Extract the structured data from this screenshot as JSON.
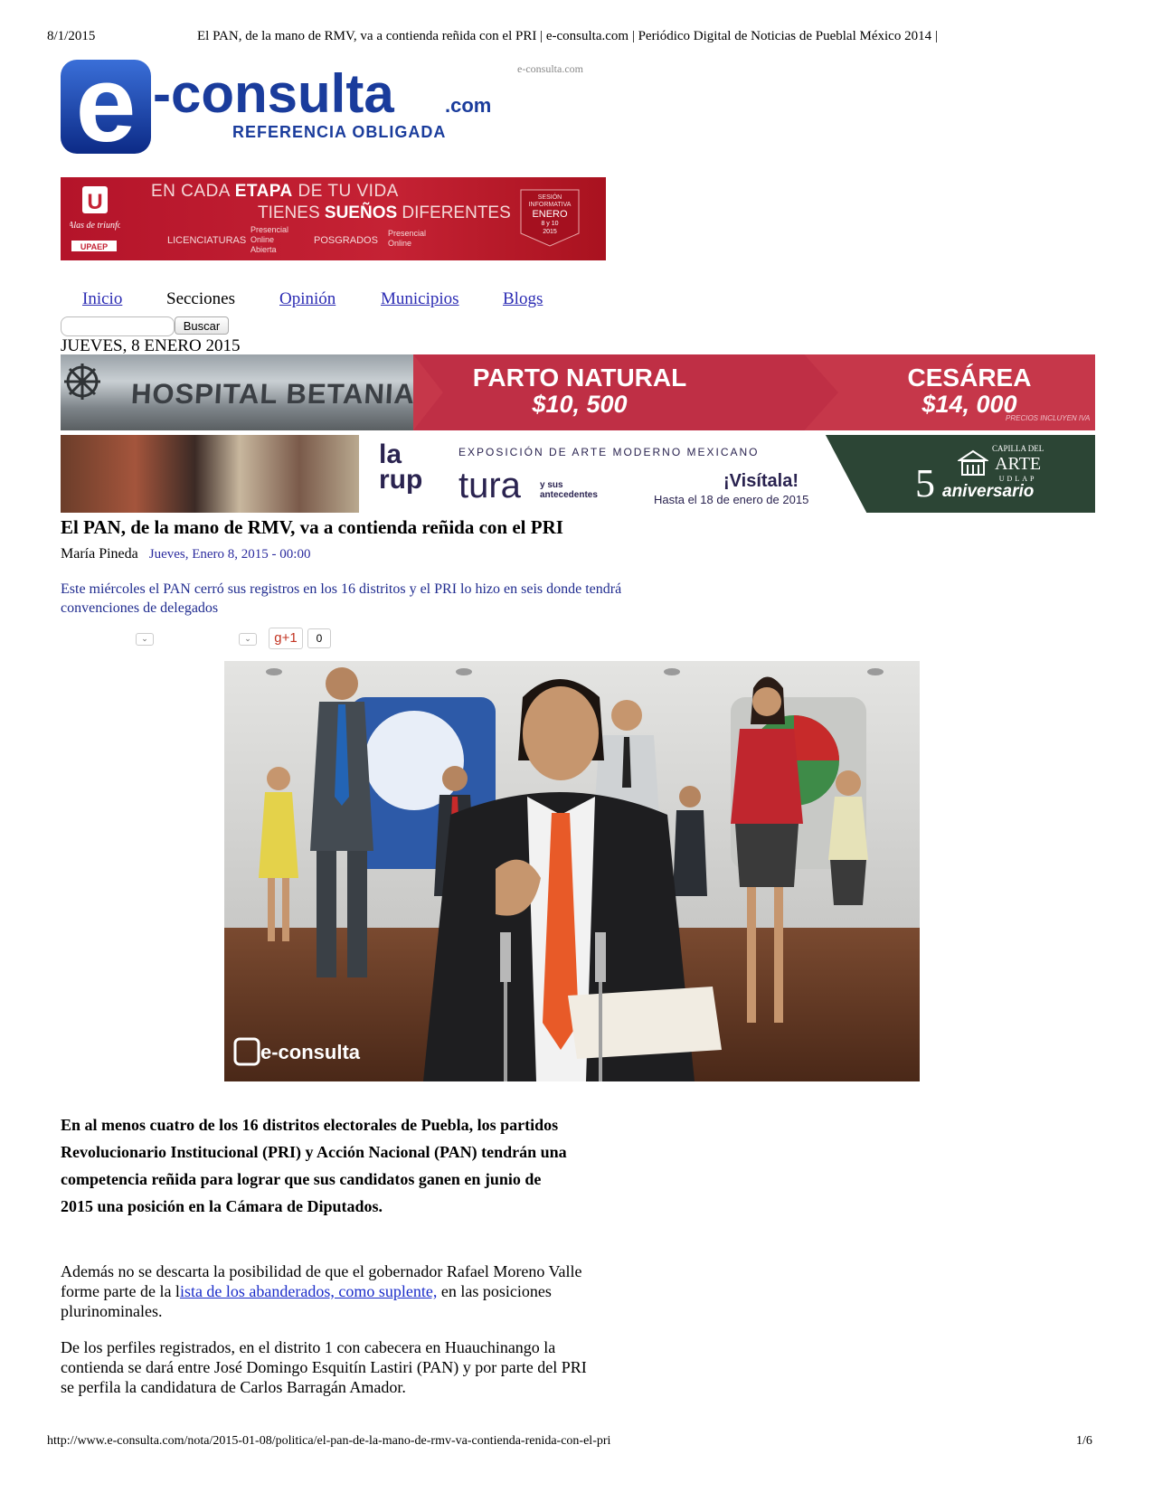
{
  "print_header": {
    "date": "8/1/2015",
    "title": "El PAN, de la mano de RMV, va a contienda reñida con el PRI | e-consulta.com | Periódico Digital de Noticias de Pueblal México 2014 |"
  },
  "logo": {
    "letter": "e",
    "name": "-consulta",
    "tld": ".com",
    "tagline": "REFERENCIA OBLIGADA",
    "site_label": "e-consulta.com",
    "colors": {
      "blue": "#1a3c9c",
      "dark": "#0a1f6e"
    }
  },
  "ad_upaep": {
    "line1_pre": "EN CADA ",
    "line1_bold": "ETAPA",
    "line1_post": " DE TU VIDA",
    "line2_pre": "TIENES ",
    "line2_bold": "SUEÑOS",
    "line2_post": " DIFERENTES",
    "licenciaturas": "LICENCIATURAS",
    "lic_sub": "Presencial\nOnline\nAbierta",
    "posgrados": "POSGRADOS",
    "pos_sub": "Presencial\nOnline",
    "badge_l1": "SESIÓN",
    "badge_l2": "INFORMATIVA",
    "badge_l3": "ENERO",
    "badge_l4": "8 y 10",
    "badge_l5": "2015",
    "brand": "UPAEP",
    "slogan": "Alas de triunfo",
    "logo_letter": "U"
  },
  "nav": {
    "items": [
      {
        "label": "Inicio",
        "link": true
      },
      {
        "label": "Secciones",
        "link": false
      },
      {
        "label": "Opinión",
        "link": true
      },
      {
        "label": "Municipios",
        "link": true
      },
      {
        "label": "Blogs",
        "link": true
      }
    ]
  },
  "search": {
    "button": "Buscar",
    "value": ""
  },
  "dateline": "JUEVES, 8 ENERO 2015",
  "ad_betania": {
    "name": "HOSPITAL BETANIA",
    "offer1": "PARTO NATURAL",
    "price1": "$10, 500",
    "offer2": "CESÁREA",
    "price2": "$14, 000",
    "note": "PRECIOS INCLUYEN IVA"
  },
  "ad_ruptura": {
    "la": "la",
    "rup": "rup",
    "tura": "tura",
    "expo": "EXPOSICIÓN DE ARTE MODERNO MEXICANO",
    "antecedentes": "y sus\nantecedentes",
    "visitala": "¡Visítala!",
    "hasta": "Hasta el 18 de enero de 2015",
    "cap1": "CAPILLA DEL",
    "cap2": "ARTE",
    "cap3": "UDLAP",
    "cinco": "5",
    "aniversario": "aniversario"
  },
  "article": {
    "title": "El PAN, de la mano de RMV, va a contienda reñida con el PRI",
    "author": "María Pineda",
    "date": "Jueves, Enero 8, 2015 - 00:00",
    "summary": "Este miércoles el PAN cerró sus registros en los 16 distritos y el PRI lo hizo en seis donde tendrá convenciones de delegados",
    "gplus_label": "g+1",
    "gplus_count": "0",
    "image_watermark": "e-consulta",
    "lead": "En al menos cuatro de los 16 distritos electorales de Puebla, los partidos Revolucionario Institucional (PRI) y Acción Nacional (PAN) tendrán una competencia reñida para lograr que sus candidatos ganen en junio de 2015 una posición en la Cámara de Diputados.",
    "p1_pre": "Además no se descarta la posibilidad de que el gobernador Rafael Moreno Valle forme parte de la l",
    "p1_link": "ista de los abanderados, como suplente,",
    "p1_post": " en las posiciones plurinominales.",
    "p2": "De los perfiles registrados, en el distrito 1 con cabecera en Huauchinango la contienda se dará entre José Domingo Esquitín Lastiri (PAN) y por parte del PRI se perfila la candidatura de Carlos Barragán Amador."
  },
  "print_footer": {
    "url": "http://www.e-consulta.com/nota/2015-01-08/politica/el-pan-de-la-mano-de-rmv-va-contienda-renida-con-el-pri",
    "page": "1/6"
  }
}
